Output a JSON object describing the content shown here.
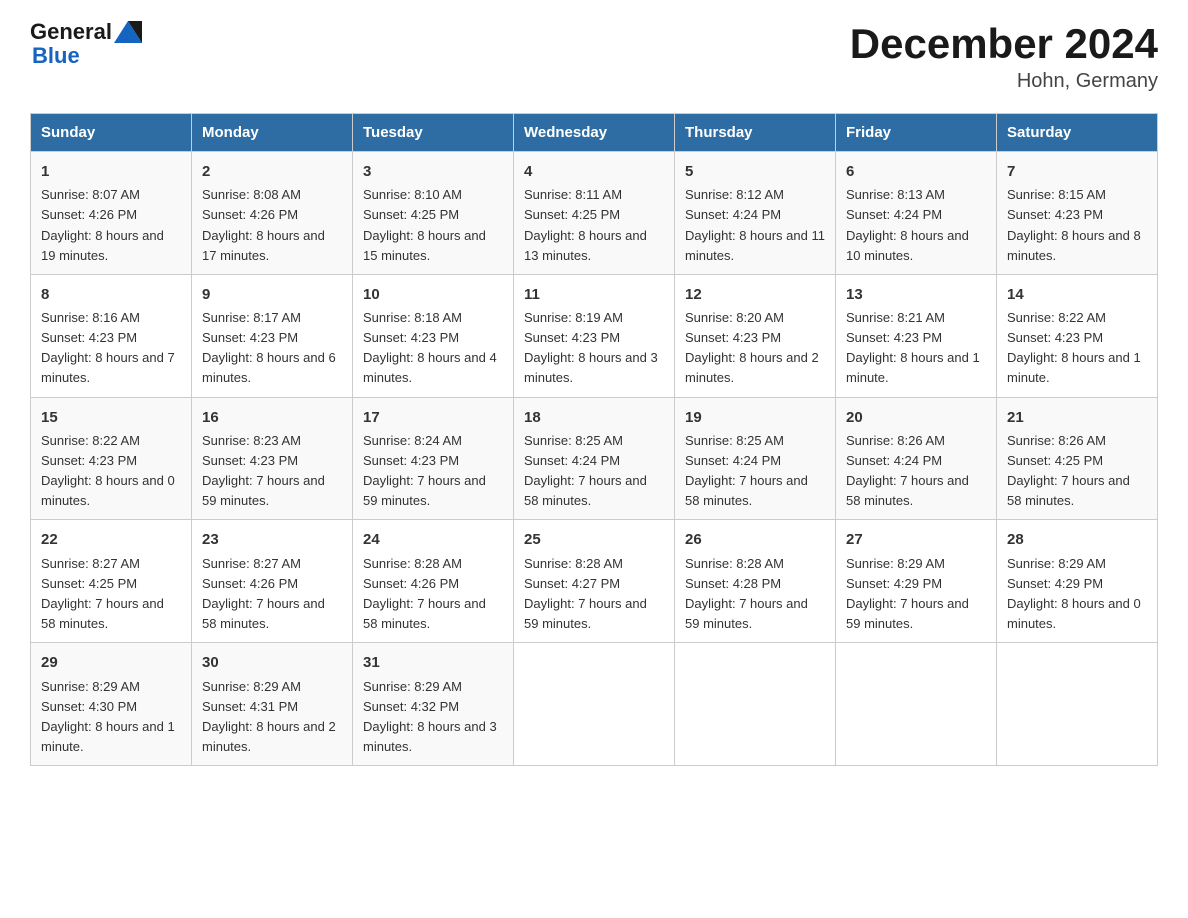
{
  "header": {
    "logo_line1": "General",
    "logo_line2": "Blue",
    "month_title": "December 2024",
    "location": "Hohn, Germany"
  },
  "weekdays": [
    "Sunday",
    "Monday",
    "Tuesday",
    "Wednesday",
    "Thursday",
    "Friday",
    "Saturday"
  ],
  "weeks": [
    [
      {
        "day": "1",
        "sunrise": "8:07 AM",
        "sunset": "4:26 PM",
        "daylight": "8 hours and 19 minutes."
      },
      {
        "day": "2",
        "sunrise": "8:08 AM",
        "sunset": "4:26 PM",
        "daylight": "8 hours and 17 minutes."
      },
      {
        "day": "3",
        "sunrise": "8:10 AM",
        "sunset": "4:25 PM",
        "daylight": "8 hours and 15 minutes."
      },
      {
        "day": "4",
        "sunrise": "8:11 AM",
        "sunset": "4:25 PM",
        "daylight": "8 hours and 13 minutes."
      },
      {
        "day": "5",
        "sunrise": "8:12 AM",
        "sunset": "4:24 PM",
        "daylight": "8 hours and 11 minutes."
      },
      {
        "day": "6",
        "sunrise": "8:13 AM",
        "sunset": "4:24 PM",
        "daylight": "8 hours and 10 minutes."
      },
      {
        "day": "7",
        "sunrise": "8:15 AM",
        "sunset": "4:23 PM",
        "daylight": "8 hours and 8 minutes."
      }
    ],
    [
      {
        "day": "8",
        "sunrise": "8:16 AM",
        "sunset": "4:23 PM",
        "daylight": "8 hours and 7 minutes."
      },
      {
        "day": "9",
        "sunrise": "8:17 AM",
        "sunset": "4:23 PM",
        "daylight": "8 hours and 6 minutes."
      },
      {
        "day": "10",
        "sunrise": "8:18 AM",
        "sunset": "4:23 PM",
        "daylight": "8 hours and 4 minutes."
      },
      {
        "day": "11",
        "sunrise": "8:19 AM",
        "sunset": "4:23 PM",
        "daylight": "8 hours and 3 minutes."
      },
      {
        "day": "12",
        "sunrise": "8:20 AM",
        "sunset": "4:23 PM",
        "daylight": "8 hours and 2 minutes."
      },
      {
        "day": "13",
        "sunrise": "8:21 AM",
        "sunset": "4:23 PM",
        "daylight": "8 hours and 1 minute."
      },
      {
        "day": "14",
        "sunrise": "8:22 AM",
        "sunset": "4:23 PM",
        "daylight": "8 hours and 1 minute."
      }
    ],
    [
      {
        "day": "15",
        "sunrise": "8:22 AM",
        "sunset": "4:23 PM",
        "daylight": "8 hours and 0 minutes."
      },
      {
        "day": "16",
        "sunrise": "8:23 AM",
        "sunset": "4:23 PM",
        "daylight": "7 hours and 59 minutes."
      },
      {
        "day": "17",
        "sunrise": "8:24 AM",
        "sunset": "4:23 PM",
        "daylight": "7 hours and 59 minutes."
      },
      {
        "day": "18",
        "sunrise": "8:25 AM",
        "sunset": "4:24 PM",
        "daylight": "7 hours and 58 minutes."
      },
      {
        "day": "19",
        "sunrise": "8:25 AM",
        "sunset": "4:24 PM",
        "daylight": "7 hours and 58 minutes."
      },
      {
        "day": "20",
        "sunrise": "8:26 AM",
        "sunset": "4:24 PM",
        "daylight": "7 hours and 58 minutes."
      },
      {
        "day": "21",
        "sunrise": "8:26 AM",
        "sunset": "4:25 PM",
        "daylight": "7 hours and 58 minutes."
      }
    ],
    [
      {
        "day": "22",
        "sunrise": "8:27 AM",
        "sunset": "4:25 PM",
        "daylight": "7 hours and 58 minutes."
      },
      {
        "day": "23",
        "sunrise": "8:27 AM",
        "sunset": "4:26 PM",
        "daylight": "7 hours and 58 minutes."
      },
      {
        "day": "24",
        "sunrise": "8:28 AM",
        "sunset": "4:26 PM",
        "daylight": "7 hours and 58 minutes."
      },
      {
        "day": "25",
        "sunrise": "8:28 AM",
        "sunset": "4:27 PM",
        "daylight": "7 hours and 59 minutes."
      },
      {
        "day": "26",
        "sunrise": "8:28 AM",
        "sunset": "4:28 PM",
        "daylight": "7 hours and 59 minutes."
      },
      {
        "day": "27",
        "sunrise": "8:29 AM",
        "sunset": "4:29 PM",
        "daylight": "7 hours and 59 minutes."
      },
      {
        "day": "28",
        "sunrise": "8:29 AM",
        "sunset": "4:29 PM",
        "daylight": "8 hours and 0 minutes."
      }
    ],
    [
      {
        "day": "29",
        "sunrise": "8:29 AM",
        "sunset": "4:30 PM",
        "daylight": "8 hours and 1 minute."
      },
      {
        "day": "30",
        "sunrise": "8:29 AM",
        "sunset": "4:31 PM",
        "daylight": "8 hours and 2 minutes."
      },
      {
        "day": "31",
        "sunrise": "8:29 AM",
        "sunset": "4:32 PM",
        "daylight": "8 hours and 3 minutes."
      },
      null,
      null,
      null,
      null
    ]
  ]
}
